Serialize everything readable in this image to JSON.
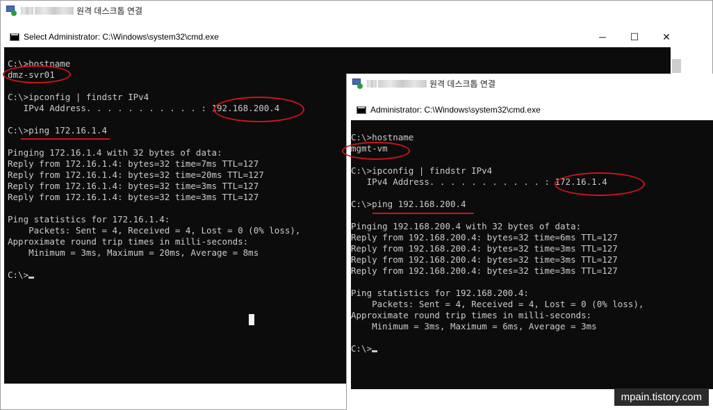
{
  "rdp_back": {
    "title": "원격 데스크톱 연결"
  },
  "cmd_back": {
    "title": "Select Administrator: C:\\Windows\\system32\\cmd.exe",
    "buttons": {
      "minimize": "─",
      "maximize": "☐",
      "close": "✕"
    },
    "lines": [
      "C:\\>hostname",
      "dmz-svr01",
      "",
      "C:\\>ipconfig | findstr IPv4",
      "   IPv4 Address. . . . . . . . . . . : 192.168.200.4",
      "",
      "C:\\>ping 172.16.1.4",
      "",
      "Pinging 172.16.1.4 with 32 bytes of data:",
      "Reply from 172.16.1.4: bytes=32 time=7ms TTL=127",
      "Reply from 172.16.1.4: bytes=32 time=20ms TTL=127",
      "Reply from 172.16.1.4: bytes=32 time=3ms TTL=127",
      "Reply from 172.16.1.4: bytes=32 time=3ms TTL=127",
      "",
      "Ping statistics for 172.16.1.4:",
      "    Packets: Sent = 4, Received = 4, Lost = 0 (0% loss),",
      "Approximate round trip times in milli-seconds:",
      "    Minimum = 3ms, Maximum = 20ms, Average = 8ms",
      "",
      "C:\\>"
    ]
  },
  "rdp_front": {
    "title": "원격 데스크톱 연결"
  },
  "cmd_front": {
    "title": "Administrator: C:\\Windows\\system32\\cmd.exe",
    "lines": [
      "C:\\>hostname",
      "mgmt-vm",
      "",
      "C:\\>ipconfig | findstr IPv4",
      "   IPv4 Address. . . . . . . . . . . : 172.16.1.4",
      "",
      "C:\\>ping 192.168.200.4",
      "",
      "Pinging 192.168.200.4 with 32 bytes of data:",
      "Reply from 192.168.200.4: bytes=32 time=6ms TTL=127",
      "Reply from 192.168.200.4: bytes=32 time=3ms TTL=127",
      "Reply from 192.168.200.4: bytes=32 time=3ms TTL=127",
      "Reply from 192.168.200.4: bytes=32 time=3ms TTL=127",
      "",
      "Ping statistics for 192.168.200.4:",
      "    Packets: Sent = 4, Received = 4, Lost = 0 (0% loss),",
      "Approximate round trip times in milli-seconds:",
      "    Minimum = 3ms, Maximum = 6ms, Average = 3ms",
      "",
      "C:\\>"
    ]
  },
  "watermark": "mpain.tistory.com",
  "colors": {
    "highlight": "#d0131b",
    "console_bg": "#0c0c0c",
    "console_fg": "#cccccc"
  }
}
